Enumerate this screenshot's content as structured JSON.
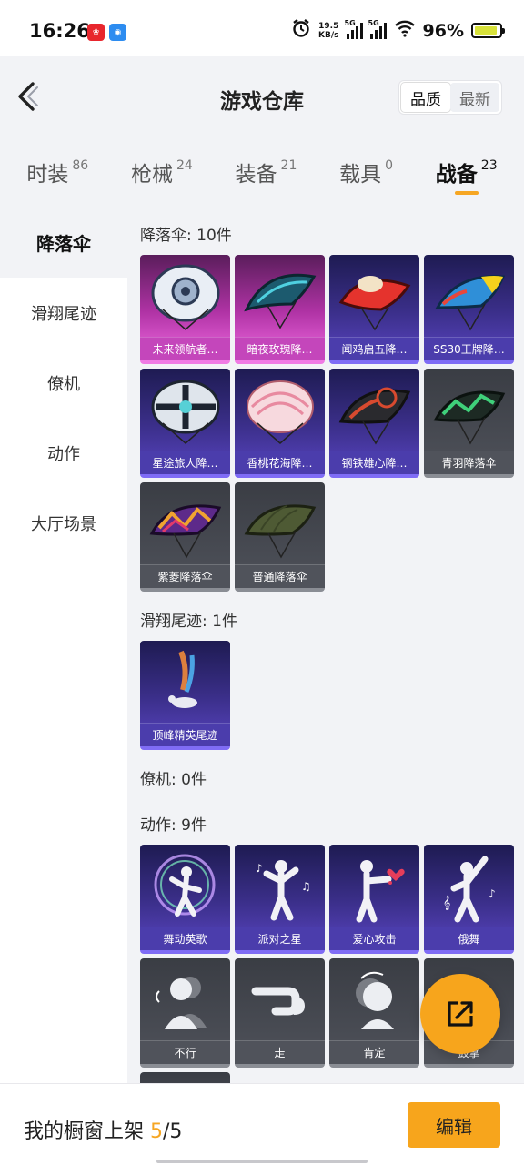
{
  "status_bar": {
    "time": "16:26",
    "net_speed": "19.5",
    "net_unit": "KB/s",
    "sig1": "5G",
    "sig2": "5G",
    "battery": "96%"
  },
  "header": {
    "title": "游戏仓库",
    "sort_quality": "品质",
    "sort_latest": "最新"
  },
  "tabs": [
    {
      "label": "时装",
      "count": "86"
    },
    {
      "label": "枪械",
      "count": "24"
    },
    {
      "label": "装备",
      "count": "21"
    },
    {
      "label": "载具",
      "count": "0"
    },
    {
      "label": "战备",
      "count": "23"
    }
  ],
  "sidebar": {
    "items": [
      {
        "label": "降落伞"
      },
      {
        "label": "滑翔尾迹"
      },
      {
        "label": "僚机"
      },
      {
        "label": "动作"
      },
      {
        "label": "大厅场景"
      }
    ]
  },
  "sections": {
    "parachute": {
      "title": "降落伞: 10件",
      "items": [
        {
          "name": "未来领航者…"
        },
        {
          "name": "暗夜玫瑰降…"
        },
        {
          "name": "闻鸡启五降…"
        },
        {
          "name": "SS30王牌降…"
        },
        {
          "name": "星途旅人降…"
        },
        {
          "name": "香桃花海降…"
        },
        {
          "name": "钢铁雄心降…"
        },
        {
          "name": "青羽降落伞"
        },
        {
          "name": "紫菱降落伞"
        },
        {
          "name": "普通降落伞"
        }
      ]
    },
    "trail": {
      "title": "滑翔尾迹: 1件",
      "items": [
        {
          "name": "顶峰精英尾迹"
        }
      ]
    },
    "wingman": {
      "title": "僚机: 0件"
    },
    "emote": {
      "title": "动作: 9件",
      "items": [
        {
          "name": "舞动英歌"
        },
        {
          "name": "派对之星"
        },
        {
          "name": "爱心攻击"
        },
        {
          "name": "俄舞"
        },
        {
          "name": "不行"
        },
        {
          "name": "走"
        },
        {
          "name": "肯定"
        },
        {
          "name": "鼓掌"
        }
      ]
    }
  },
  "bottom": {
    "prefix": "我的橱窗上架 ",
    "current": "5",
    "suffix": "/5",
    "edit_label": "编辑"
  },
  "colors": {
    "accent": "#f7a51c",
    "rarity_pink": "#c446bb",
    "rarity_purple": "#4b3dac",
    "rarity_gray": "#50535b"
  }
}
